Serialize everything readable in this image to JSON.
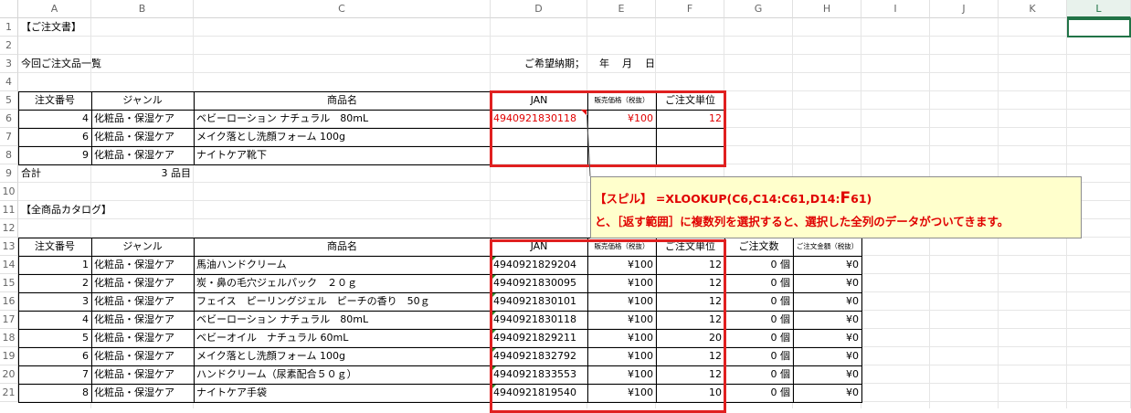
{
  "columns": [
    "A",
    "B",
    "C",
    "D",
    "E",
    "F",
    "G",
    "H",
    "I",
    "J",
    "K",
    "L"
  ],
  "rows": [
    "1",
    "2",
    "3",
    "4",
    "5",
    "6",
    "7",
    "8",
    "9",
    "10",
    "11",
    "12",
    "13",
    "14",
    "15",
    "16",
    "17",
    "18",
    "19",
    "20",
    "21"
  ],
  "title": "【ご注文書】",
  "order_list_title": "今回ご注文品一覧",
  "delivery": {
    "label": "ご希望納期；",
    "year": "年",
    "month": "月",
    "day": "日"
  },
  "order_header": {
    "no": "注文番号",
    "genre": "ジャンル",
    "name": "商品名",
    "jan": "JAN",
    "price": "販売価格（税抜）",
    "unit": "ご注文単位"
  },
  "order_rows": [
    {
      "no": "4",
      "genre": "化粧品・保湿ケア",
      "name": "ベビーローション ナチュラル　80mL",
      "jan": "4940921830118",
      "price": "¥100",
      "unit": "12"
    },
    {
      "no": "6",
      "genre": "化粧品・保湿ケア",
      "name": "メイク落とし洗顔フォーム 100g",
      "jan": "",
      "price": "",
      "unit": ""
    },
    {
      "no": "9",
      "genre": "化粧品・保湿ケア",
      "name": "ナイトケア靴下",
      "jan": "",
      "price": "",
      "unit": ""
    }
  ],
  "total": {
    "label": "合計",
    "value": "3 品目"
  },
  "catalog_title": "【全商品カタログ】",
  "catalog_header": {
    "no": "注文番号",
    "genre": "ジャンル",
    "name": "商品名",
    "jan": "JAN",
    "price": "販売価格（税抜）",
    "unit": "ご注文単位",
    "qty": "ご注文数",
    "amount": "ご注文金額（税抜）"
  },
  "catalog_rows": [
    {
      "no": "1",
      "genre": "化粧品・保湿ケア",
      "name": "馬油ハンドクリーム",
      "jan": "4940921829204",
      "price": "¥100",
      "unit": "12",
      "qty": "0 個",
      "amount": "¥0"
    },
    {
      "no": "2",
      "genre": "化粧品・保湿ケア",
      "name": "炭・鼻の毛穴ジェルパック　２０ｇ",
      "jan": "4940921830095",
      "price": "¥100",
      "unit": "12",
      "qty": "0 個",
      "amount": "¥0"
    },
    {
      "no": "3",
      "genre": "化粧品・保湿ケア",
      "name": "フェイス　ピーリングジェル　ピーチの香り　50ｇ",
      "jan": "4940921830101",
      "price": "¥100",
      "unit": "12",
      "qty": "0 個",
      "amount": "¥0"
    },
    {
      "no": "4",
      "genre": "化粧品・保湿ケア",
      "name": "ベビーローション ナチュラル　80mL",
      "jan": "4940921830118",
      "price": "¥100",
      "unit": "12",
      "qty": "0 個",
      "amount": "¥0"
    },
    {
      "no": "5",
      "genre": "化粧品・保湿ケア",
      "name": "ベビーオイル　ナチュラル 60mL",
      "jan": "4940921829211",
      "price": "¥100",
      "unit": "20",
      "qty": "0 個",
      "amount": "¥0"
    },
    {
      "no": "6",
      "genre": "化粧品・保湿ケア",
      "name": "メイク落とし洗顔フォーム 100g",
      "jan": "4940921832792",
      "price": "¥100",
      "unit": "12",
      "qty": "0 個",
      "amount": "¥0"
    },
    {
      "no": "7",
      "genre": "化粧品・保湿ケア",
      "name": "ハンドクリーム（尿素配合５０ｇ）",
      "jan": "4940921833553",
      "price": "¥100",
      "unit": "12",
      "qty": "0 個",
      "amount": "¥0"
    },
    {
      "no": "8",
      "genre": "化粧品・保湿ケア",
      "name": "ナイトケア手袋",
      "jan": "4940921819540",
      "price": "¥100",
      "unit": "10",
      "qty": "0 個",
      "amount": "¥0"
    }
  ],
  "note": {
    "line1_prefix": "【スピル】 =XLOOKUP(C6,C14:C61,D14:",
    "line1_big": "F",
    "line1_suffix": "61)",
    "line2": "と、［返す範囲］に複数列を選択すると、選択した全列のデータがついてきます。"
  },
  "colors": {
    "red": "#e00000",
    "note_bg": "#ffffcc",
    "select_green": "#217346"
  }
}
